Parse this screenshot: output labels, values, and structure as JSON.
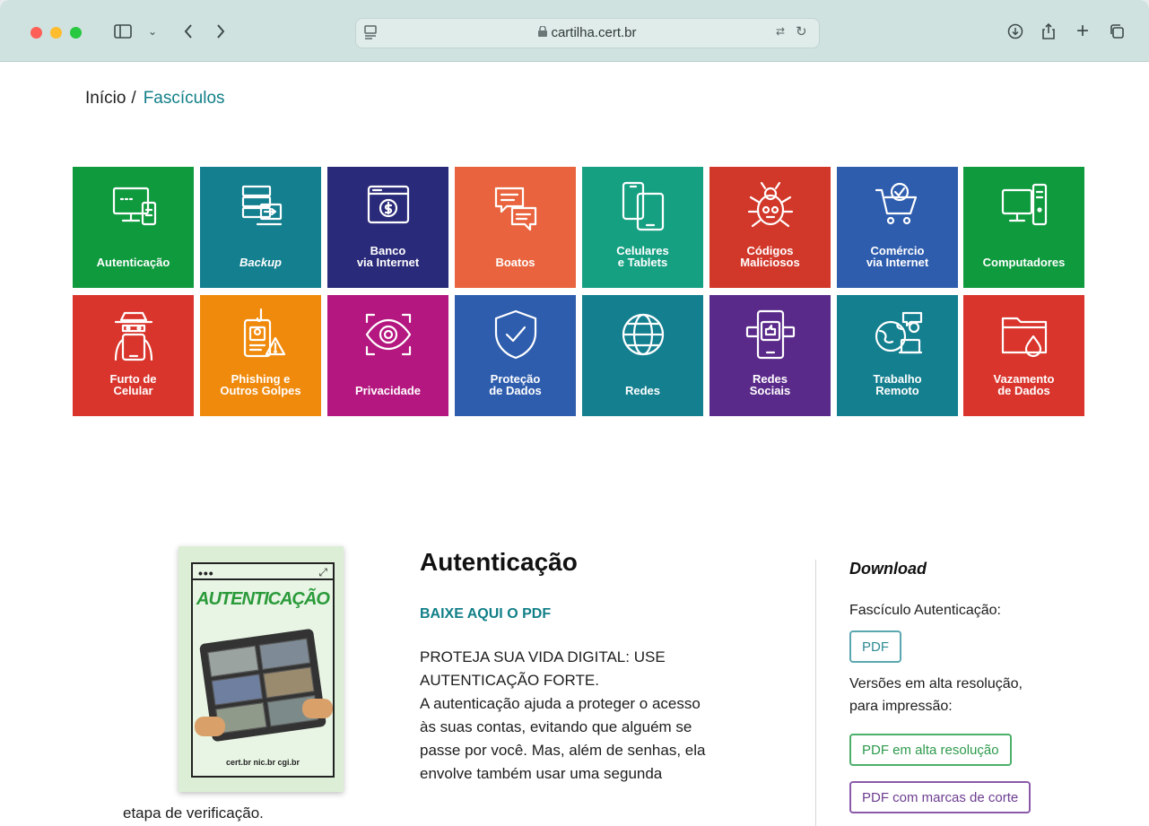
{
  "browser": {
    "url": "cartilha.cert.br"
  },
  "breadcrumb": {
    "home": "Início",
    "separator": "/",
    "current": "Fascículos"
  },
  "tiles": [
    {
      "label": "Autenticação",
      "color": "#0f9a3e",
      "icon": "login-screen-icon"
    },
    {
      "label": "Backup",
      "color": "#137f8f",
      "icon": "backup-server-icon",
      "italic": true
    },
    {
      "label": "Banco\nvia Internet",
      "color": "#2a2a7a",
      "icon": "bank-window-icon"
    },
    {
      "label": "Boatos",
      "color": "#e9643e",
      "icon": "chat-bubbles-icon"
    },
    {
      "label": "Celulares\ne Tablets",
      "color": "#16a082",
      "icon": "phone-tablet-icon"
    },
    {
      "label": "Códigos\nMaliciosos",
      "color": "#d2382a",
      "icon": "bug-skull-icon"
    },
    {
      "label": "Comércio\nvia Internet",
      "color": "#2e5dae",
      "icon": "shopping-cart-icon"
    },
    {
      "label": "Computadores",
      "color": "#0f9a3e",
      "icon": "desktop-computer-icon"
    },
    {
      "label": "Furto de\nCelular",
      "color": "#d9352c",
      "icon": "thief-phone-icon"
    },
    {
      "label": "Phishing e\nOutros Golpes",
      "color": "#f08a0c",
      "icon": "phishing-phone-icon"
    },
    {
      "label": "Privacidade",
      "color": "#b4177f",
      "icon": "eye-icon"
    },
    {
      "label": "Proteção\nde Dados",
      "color": "#2e5dae",
      "icon": "shield-check-icon"
    },
    {
      "label": "Redes",
      "color": "#137f8f",
      "icon": "globe-icon"
    },
    {
      "label": "Redes\nSociais",
      "color": "#5a2a8a",
      "icon": "social-phone-icon"
    },
    {
      "label": "Trabalho\nRemoto",
      "color": "#137f8f",
      "icon": "remote-work-icon"
    },
    {
      "label": "Vazamento\nde Dados",
      "color": "#d9352c",
      "icon": "folder-leak-icon"
    }
  ],
  "cover": {
    "title": "AUTENTICAÇÃO",
    "footer": "cert.br nic.br cgi.br"
  },
  "article": {
    "title": "Autenticação",
    "download_link": "BAIXE AQUI O PDF",
    "lines": [
      "PROTEJA SUA VIDA DIGITAL: USE",
      "AUTENTICAÇÃO FORTE.",
      "A autenticação ajuda a proteger o acesso",
      "às suas contas, evitando que alguém se",
      "passe por você. Mas, além de senhas, ela",
      "envolve também usar uma segunda"
    ],
    "overflow_line": "etapa de verificação."
  },
  "download": {
    "title": "Download",
    "label_pdf": "Fascículo Autenticação:",
    "btn_pdf": "PDF",
    "label_print": "Versões em alta resolução,\npara impressão:",
    "btn_hires": "PDF em alta resolução",
    "btn_crop": "PDF com marcas de corte"
  }
}
